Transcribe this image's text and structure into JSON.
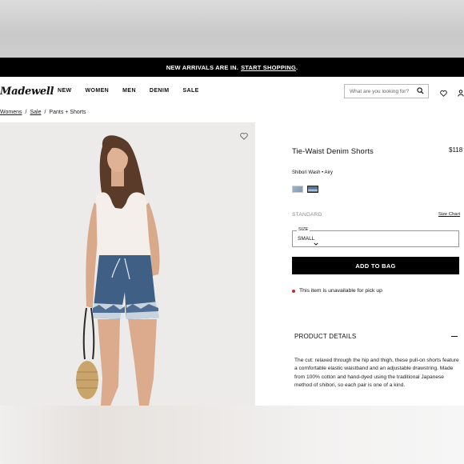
{
  "banner": {
    "text": "NEW ARRIVALS ARE IN.",
    "link": "START SHOPPING",
    "after": "."
  },
  "brand": "Madewell",
  "nav": {
    "items": [
      "NEW",
      "WOMEN",
      "MEN",
      "DENIM",
      "SALE"
    ]
  },
  "search": {
    "placeholder": "What are you looking for?"
  },
  "breadcrumb": {
    "items": [
      "Womens",
      "Sale",
      "Pants + Shorts"
    ],
    "separator": "/"
  },
  "product": {
    "title": "Tie-Waist Denim Shorts",
    "price": "$118",
    "color_label": "Shibori Wash • Airy",
    "fit": "STANDARD",
    "size_chart": "Size Chart",
    "size_label": "SIZE",
    "size_value": "SMALL",
    "add_to_bag": "ADD TO BAG",
    "pickup_notice": "This item is unavailable for pick up",
    "details_heading": "PRODUCT DETAILS",
    "description": "The cut: relaxed through the hip and thigh, these pull-on shorts feature a comfortable elastic waistband and an adjustable drawstring. Made from 100% cotton and hand-dyed using the traditional Japanese method of shibori, so each pair is one of a kind."
  },
  "colors": {
    "accent": "#000000",
    "alert": "#c3283c",
    "photo_bg": "#ecebea"
  }
}
